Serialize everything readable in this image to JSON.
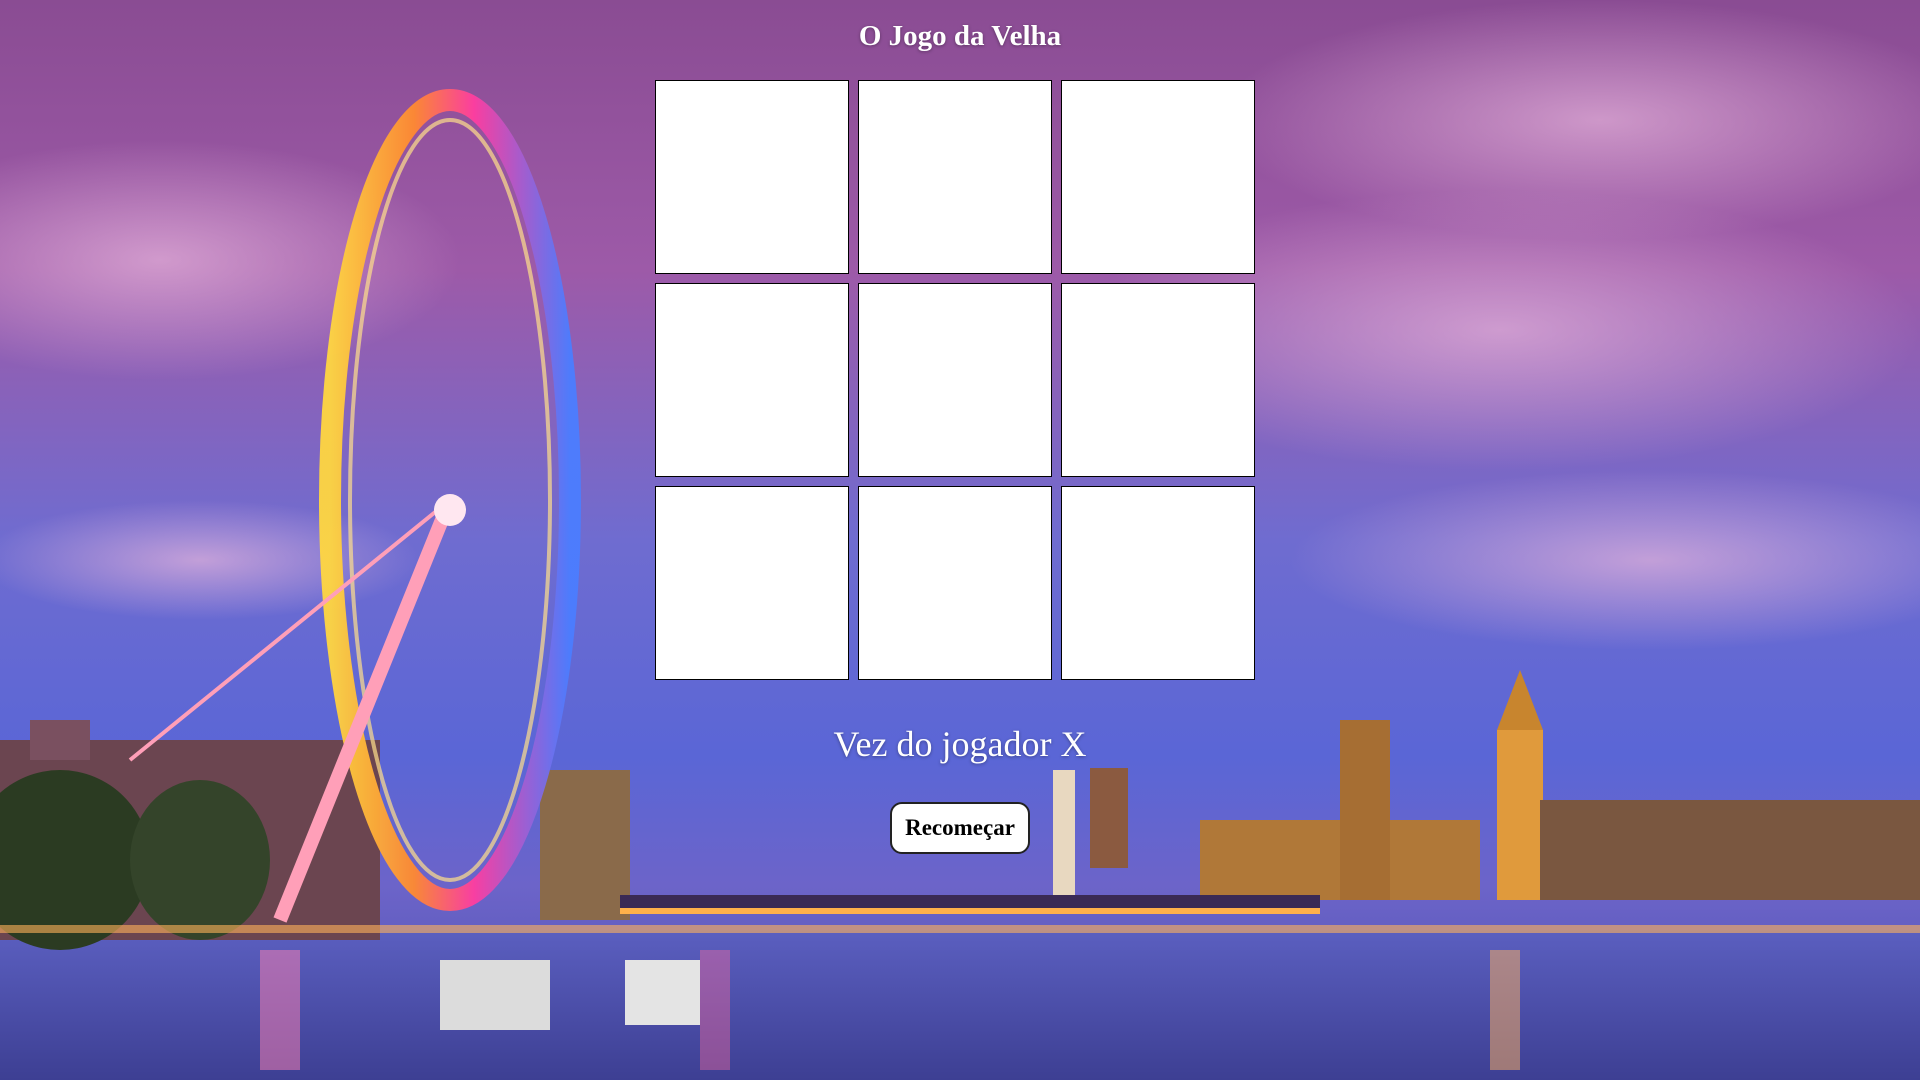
{
  "page": {
    "title": "O Jogo da Velha",
    "status": "Vez do jogador X",
    "restart_label": "Recomeçar"
  },
  "board": {
    "cells": [
      "",
      "",
      "",
      "",
      "",
      "",
      "",
      "",
      ""
    ]
  },
  "background": {
    "description_colors": {
      "sky_top": "#8c4f9c",
      "sky_mid": "#5e6bd0",
      "horizon": "#7a6fd3",
      "water": "#4d4fae",
      "cell_fill": "#ffffff",
      "cell_border": "#000000"
    }
  }
}
